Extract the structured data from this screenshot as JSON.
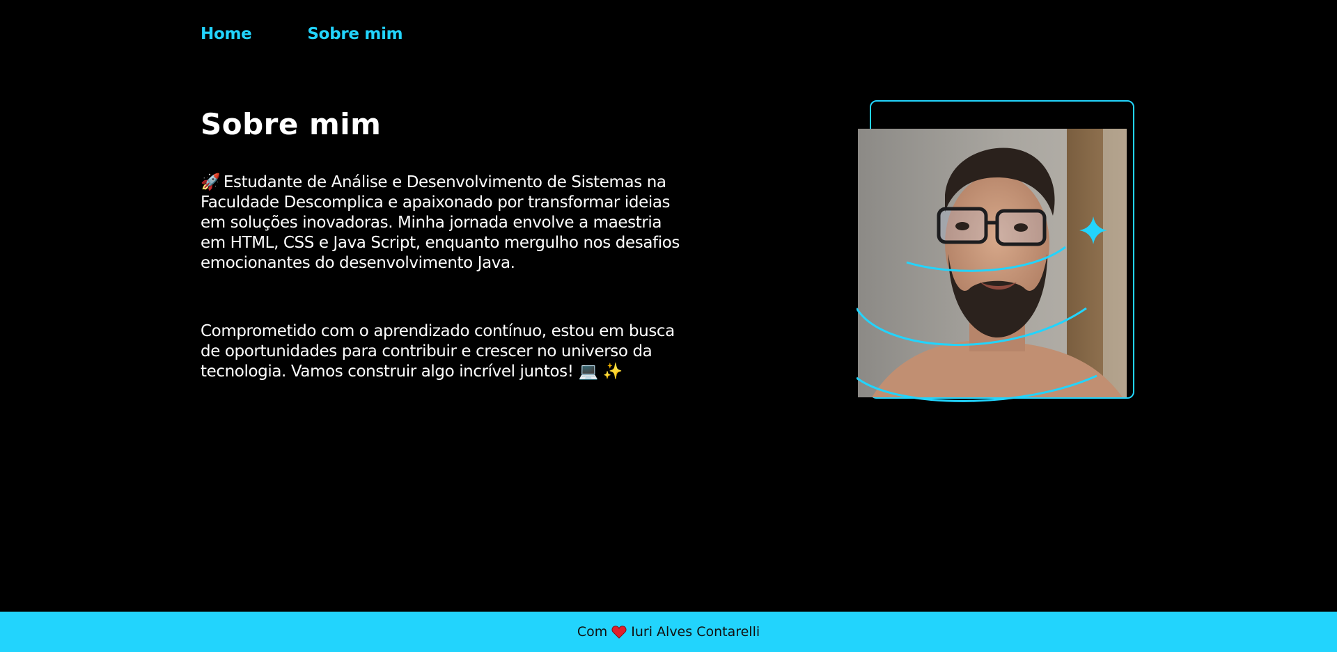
{
  "nav": {
    "home_label": "Home",
    "about_label": "Sobre mim"
  },
  "main": {
    "title": "Sobre mim",
    "paragraph1_emoji": "🚀",
    "paragraph1": "Estudante de Análise e Desenvolvimento de Sistemas na Faculdade Descomplica e apaixonado por transformar ideias em soluções inovadoras. Minha jornada envolve a maestria em HTML, CSS e Java Script, enquanto mergulho nos desafios emocionantes do desenvolvimento Java.",
    "paragraph2": "Comprometido com o aprendizado contínuo, estou em busca de oportunidades para contribuir e crescer no universo da tecnologia. Vamos construir algo incrível juntos!",
    "paragraph2_emojis": "💻 ✨"
  },
  "footer": {
    "prefix": "Com",
    "heart_icon": "heart-icon",
    "author": "Iuri Alves Contarelli"
  },
  "colors": {
    "accent": "#22d4fd",
    "background": "#000000",
    "text": "#ffffff",
    "heart": "#e0202b"
  }
}
